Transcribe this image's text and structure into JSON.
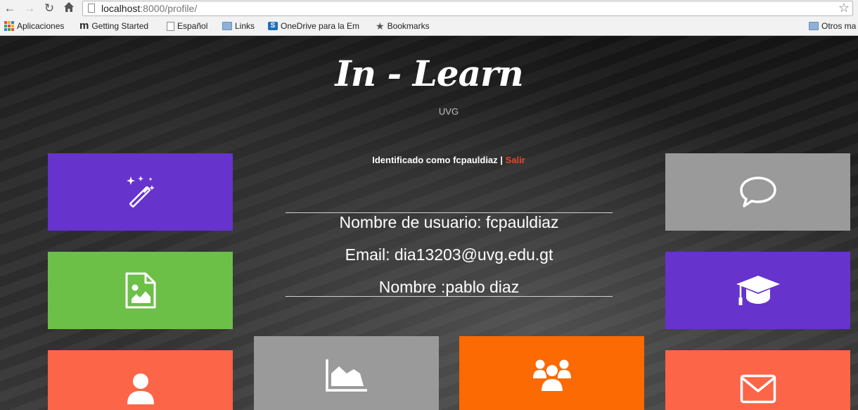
{
  "browser": {
    "url_host": "localhost",
    "url_path": ":8000/profile/",
    "bookmarks": [
      {
        "label": "Aplicaciones",
        "icon": "apps-grid-icon"
      },
      {
        "label": "Getting Started",
        "icon": "getting-started-icon"
      },
      {
        "label": "Español",
        "icon": "page-icon"
      },
      {
        "label": "Links",
        "icon": "folder-icon"
      },
      {
        "label": "OneDrive para la Em",
        "icon": "sharepoint-icon"
      },
      {
        "label": "Bookmarks",
        "icon": "star-icon"
      },
      {
        "label": "Otros ma",
        "icon": "folder-icon"
      }
    ]
  },
  "site": {
    "title": "In - Learn",
    "subtitle": "UVG"
  },
  "session": {
    "prefix": "Identificado como fcpauldiaz",
    "separator": "|",
    "logout": "Salir"
  },
  "profile": {
    "username_line": "Nombre de usuario: fcpauldiaz",
    "email_line": "Email: dia13203@uvg.edu.gt",
    "name_line": "Nombre :pablo diaz"
  },
  "tiles": [
    {
      "icon": "magic-wand-icon",
      "color": "#6633cc"
    },
    {
      "icon": "image-file-icon",
      "color": "#6cbf47"
    },
    {
      "icon": "user-icon",
      "color": "#fc6548"
    },
    {
      "icon": "area-chart-icon",
      "color": "#9a9a9a"
    },
    {
      "icon": "group-icon",
      "color": "#fc6a03"
    },
    {
      "icon": "chat-bubble-icon",
      "color": "#9a9a9a"
    },
    {
      "icon": "graduation-cap-icon",
      "color": "#6633cc"
    },
    {
      "icon": "envelope-icon",
      "color": "#fc6548"
    }
  ]
}
